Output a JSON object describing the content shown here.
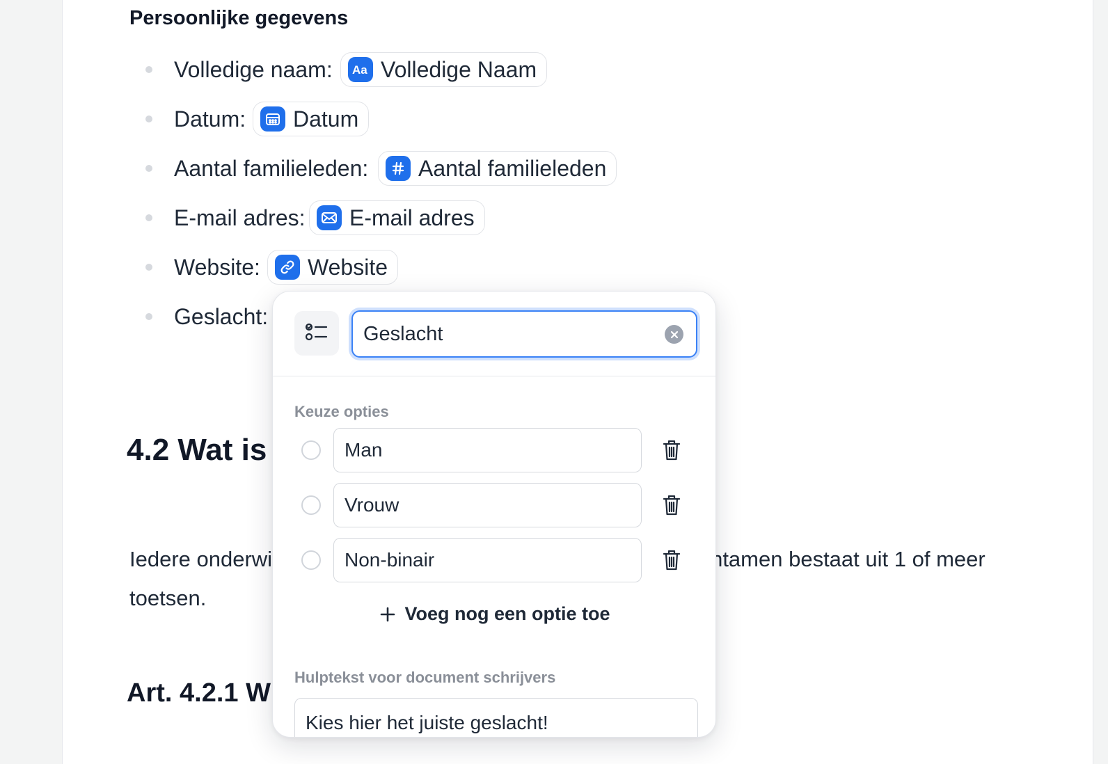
{
  "section": {
    "title": "Persoonlijke gegevens"
  },
  "fields": [
    {
      "label": "Volledige naam:",
      "chip": "Volledige Naam",
      "icon": "text-type-icon"
    },
    {
      "label": "Datum:",
      "chip": "Datum",
      "icon": "calendar-icon"
    },
    {
      "label": "Aantal familieleden:",
      "chip": "Aantal familieleden",
      "icon": "hash-icon"
    },
    {
      "label": "E-mail adres:",
      "chip": "E-mail adres",
      "icon": "mail-icon"
    },
    {
      "label": "Website:",
      "chip": "Website",
      "icon": "link-icon"
    },
    {
      "label": "Geslacht:"
    }
  ],
  "content": {
    "heading_42": "4.2  Wat is",
    "body_start": "Iedere onderwi",
    "body_end": "ntamen bestaat uit 1 of meer",
    "body_line2": "toetsen.",
    "art_heading": "Art. 4.2.1  W"
  },
  "popover": {
    "field_type_icon": "choice-list-icon",
    "name_value": "Geslacht",
    "options_label": "Keuze opties",
    "options": [
      "Man",
      "Vrouw",
      "Non-binair"
    ],
    "add_option_label": "Voeg nog een optie toe",
    "help_label": "Hulptekst voor document schrijvers",
    "help_value": "Kies hier het juiste geslacht!"
  },
  "colors": {
    "accent": "#1f6feb",
    "focus_ring": "#3b82f6",
    "muted_label": "#8a8f98"
  }
}
